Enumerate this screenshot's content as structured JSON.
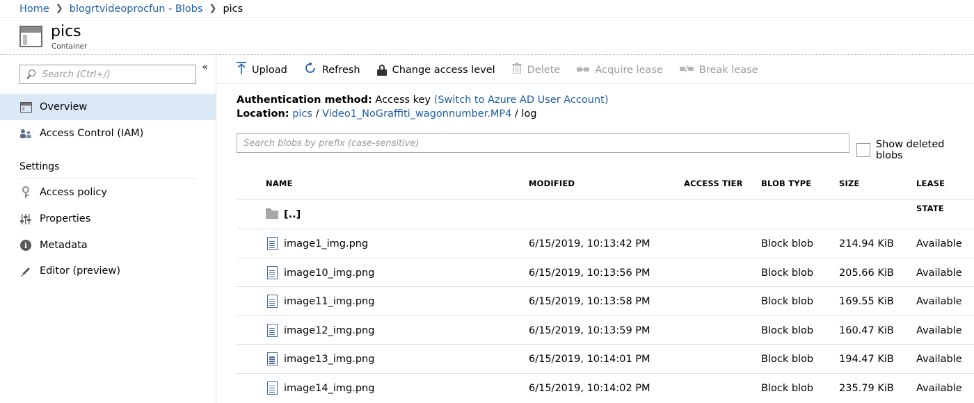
{
  "breadcrumb": {
    "home": "Home",
    "account": "blogrtvideoprocfun - Blobs",
    "current": "pics"
  },
  "header": {
    "title": "pics",
    "subtitle": "Container"
  },
  "sidebar": {
    "search_placeholder": "Search (Ctrl+/)",
    "collapse_glyph": "«",
    "items": [
      {
        "label": "Overview",
        "icon": "overview-icon",
        "selected": true
      },
      {
        "label": "Access Control (IAM)",
        "icon": "people-icon"
      }
    ],
    "settings_heading": "Settings",
    "settings_items": [
      {
        "label": "Access policy",
        "icon": "key-icon"
      },
      {
        "label": "Properties",
        "icon": "sliders-icon"
      },
      {
        "label": "Metadata",
        "icon": "info-icon"
      },
      {
        "label": "Editor (preview)",
        "icon": "pencil-icon"
      }
    ]
  },
  "toolbar": {
    "upload": "Upload",
    "refresh": "Refresh",
    "change_access": "Change access level",
    "delete": "Delete",
    "acquire_lease": "Acquire lease",
    "break_lease": "Break lease"
  },
  "info": {
    "auth_label": "Authentication method:",
    "auth_value": "Access key",
    "auth_link": "(Switch to Azure AD User Account)",
    "location_label": "Location:",
    "location_parts": [
      "pics",
      "Video1_NoGraffiti_wagonnumber.MP4",
      "log"
    ],
    "sep": "/"
  },
  "blob_search": {
    "placeholder": "Search blobs by prefix (case-sensitive)",
    "show_deleted_label": "Show deleted blobs",
    "show_deleted_checked": false
  },
  "table": {
    "columns": [
      "NAME",
      "MODIFIED",
      "ACCESS TIER",
      "BLOB TYPE",
      "SIZE",
      "LEASE STATE"
    ],
    "parent_row": "[..]",
    "rows": [
      {
        "name": "image1_img.png",
        "modified": "6/15/2019, 10:13:42 PM",
        "tier": "",
        "type": "Block blob",
        "size": "214.94 KiB",
        "lease": "Available"
      },
      {
        "name": "image10_img.png",
        "modified": "6/15/2019, 10:13:56 PM",
        "tier": "",
        "type": "Block blob",
        "size": "205.66 KiB",
        "lease": "Available"
      },
      {
        "name": "image11_img.png",
        "modified": "6/15/2019, 10:13:58 PM",
        "tier": "",
        "type": "Block blob",
        "size": "169.55 KiB",
        "lease": "Available"
      },
      {
        "name": "image12_img.png",
        "modified": "6/15/2019, 10:13:59 PM",
        "tier": "",
        "type": "Block blob",
        "size": "160.47 KiB",
        "lease": "Available"
      },
      {
        "name": "image13_img.png",
        "modified": "6/15/2019, 10:14:01 PM",
        "tier": "",
        "type": "Block blob",
        "size": "194.47 KiB",
        "lease": "Available"
      },
      {
        "name": "image14_img.png",
        "modified": "6/15/2019, 10:14:02 PM",
        "tier": "",
        "type": "Block blob",
        "size": "235.79 KiB",
        "lease": "Available"
      }
    ]
  },
  "colors": {
    "link": "#1f5fa6",
    "selected_nav": "#dbe9f7",
    "disabled_text": "#9a9a9a"
  }
}
